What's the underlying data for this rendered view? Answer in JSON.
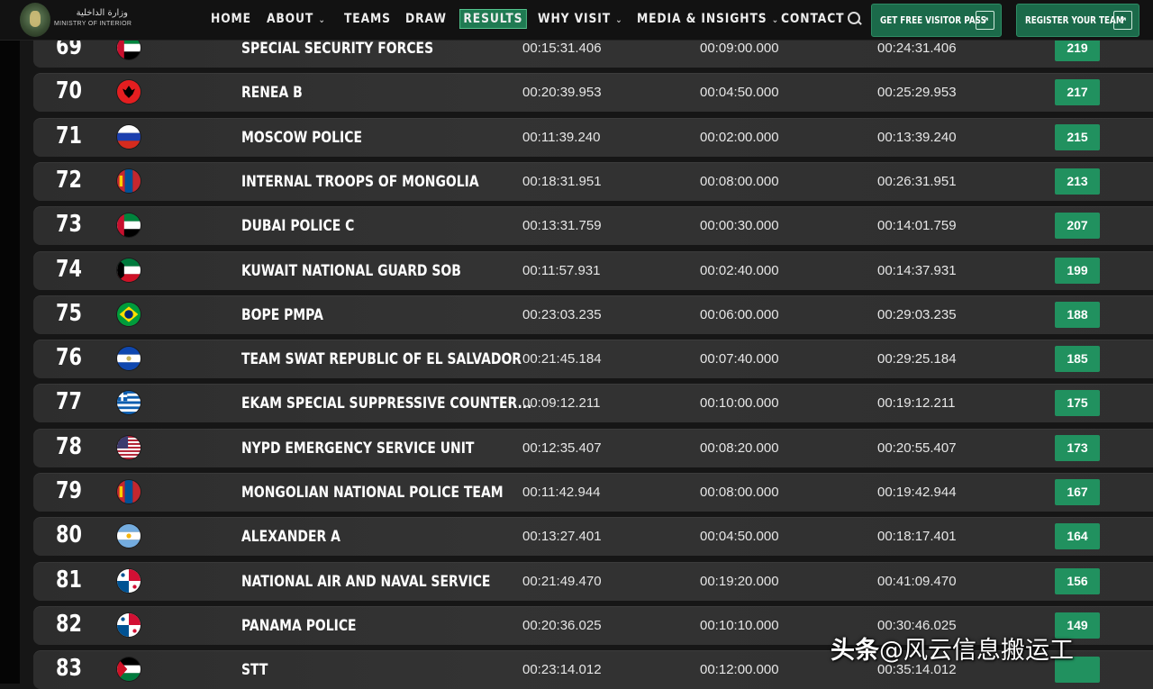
{
  "header": {
    "logo_ar": "وزارة الداخلية",
    "logo_en": "MINISTRY OF INTERIOR",
    "nav": [
      {
        "label": "HOME",
        "dropdown": false,
        "active": false
      },
      {
        "label": "ABOUT",
        "dropdown": true,
        "active": false
      },
      {
        "label": "TEAMS",
        "dropdown": false,
        "active": false
      },
      {
        "label": "DRAW",
        "dropdown": false,
        "active": false
      },
      {
        "label": "RESULTS",
        "dropdown": false,
        "active": true
      },
      {
        "label": "WHY VISIT",
        "dropdown": true,
        "active": false
      },
      {
        "label": "MEDIA & INSIGHTS",
        "dropdown": true,
        "active": false
      },
      {
        "label": "CONTACT",
        "dropdown": false,
        "active": false
      }
    ],
    "cta_visitor": "GET FREE VISITOR PASS",
    "cta_register": "REGISTER YOUR TEAM",
    "arrow_glyph": "↗",
    "chevron_glyph": "⌄"
  },
  "results": [
    {
      "rank": "69",
      "flag": "uae",
      "team": "SPECIAL SECURITY FORCES",
      "time": "00:15:31.406",
      "penalty": "00:09:00.000",
      "total": "00:24:31.406",
      "score": "219"
    },
    {
      "rank": "70",
      "flag": "albania",
      "team": "RENEA B",
      "time": "00:20:39.953",
      "penalty": "00:04:50.000",
      "total": "00:25:29.953",
      "score": "217"
    },
    {
      "rank": "71",
      "flag": "russia",
      "team": "MOSCOW POLICE",
      "time": "00:11:39.240",
      "penalty": "00:02:00.000",
      "total": "00:13:39.240",
      "score": "215"
    },
    {
      "rank": "72",
      "flag": "mongolia",
      "team": "INTERNAL TROOPS OF MONGOLIA",
      "time": "00:18:31.951",
      "penalty": "00:08:00.000",
      "total": "00:26:31.951",
      "score": "213"
    },
    {
      "rank": "73",
      "flag": "uae",
      "team": "DUBAI POLICE C",
      "time": "00:13:31.759",
      "penalty": "00:00:30.000",
      "total": "00:14:01.759",
      "score": "207"
    },
    {
      "rank": "74",
      "flag": "kuwait",
      "team": "KUWAIT NATIONAL GUARD SOB",
      "time": "00:11:57.931",
      "penalty": "00:02:40.000",
      "total": "00:14:37.931",
      "score": "199"
    },
    {
      "rank": "75",
      "flag": "brazil",
      "team": "BOPE PMPA",
      "time": "00:23:03.235",
      "penalty": "00:06:00.000",
      "total": "00:29:03.235",
      "score": "188"
    },
    {
      "rank": "76",
      "flag": "el-salvador",
      "team": "TEAM SWAT REPUBLIC OF EL SALVADOR",
      "time": "00:21:45.184",
      "penalty": "00:07:40.000",
      "total": "00:29:25.184",
      "score": "185"
    },
    {
      "rank": "77",
      "flag": "greece",
      "team": "EKAM SPECIAL SUPPRESSIVE COUNTER...",
      "time": "00:09:12.211",
      "penalty": "00:10:00.000",
      "total": "00:19:12.211",
      "score": "175"
    },
    {
      "rank": "78",
      "flag": "usa",
      "team": "NYPD EMERGENCY SERVICE UNIT",
      "time": "00:12:35.407",
      "penalty": "00:08:20.000",
      "total": "00:20:55.407",
      "score": "173"
    },
    {
      "rank": "79",
      "flag": "mongolia",
      "team": "MONGOLIAN NATIONAL POLICE TEAM",
      "time": "00:11:42.944",
      "penalty": "00:08:00.000",
      "total": "00:19:42.944",
      "score": "167"
    },
    {
      "rank": "80",
      "flag": "argentina",
      "team": "ALEXANDER A",
      "time": "00:13:27.401",
      "penalty": "00:04:50.000",
      "total": "00:18:17.401",
      "score": "164"
    },
    {
      "rank": "81",
      "flag": "panama",
      "team": "NATIONAL AIR AND NAVAL SERVICE",
      "time": "00:21:49.470",
      "penalty": "00:19:20.000",
      "total": "00:41:09.470",
      "score": "156"
    },
    {
      "rank": "82",
      "flag": "panama",
      "team": "PANAMA POLICE",
      "time": "00:20:36.025",
      "penalty": "00:10:10.000",
      "total": "00:30:46.025",
      "score": "149"
    },
    {
      "rank": "83",
      "flag": "palestine",
      "team": "STT",
      "time": "00:23:14.012",
      "penalty": "00:12:00.000",
      "total": "00:35:14.012",
      "score": ""
    }
  ],
  "watermark": {
    "brand": "头条",
    "handle": "@风云信息搬运工"
  },
  "colors": {
    "accent": "#1f7a52",
    "score_bg": "#21915f",
    "row_bg": "#303030",
    "page_bg": "#161616"
  }
}
